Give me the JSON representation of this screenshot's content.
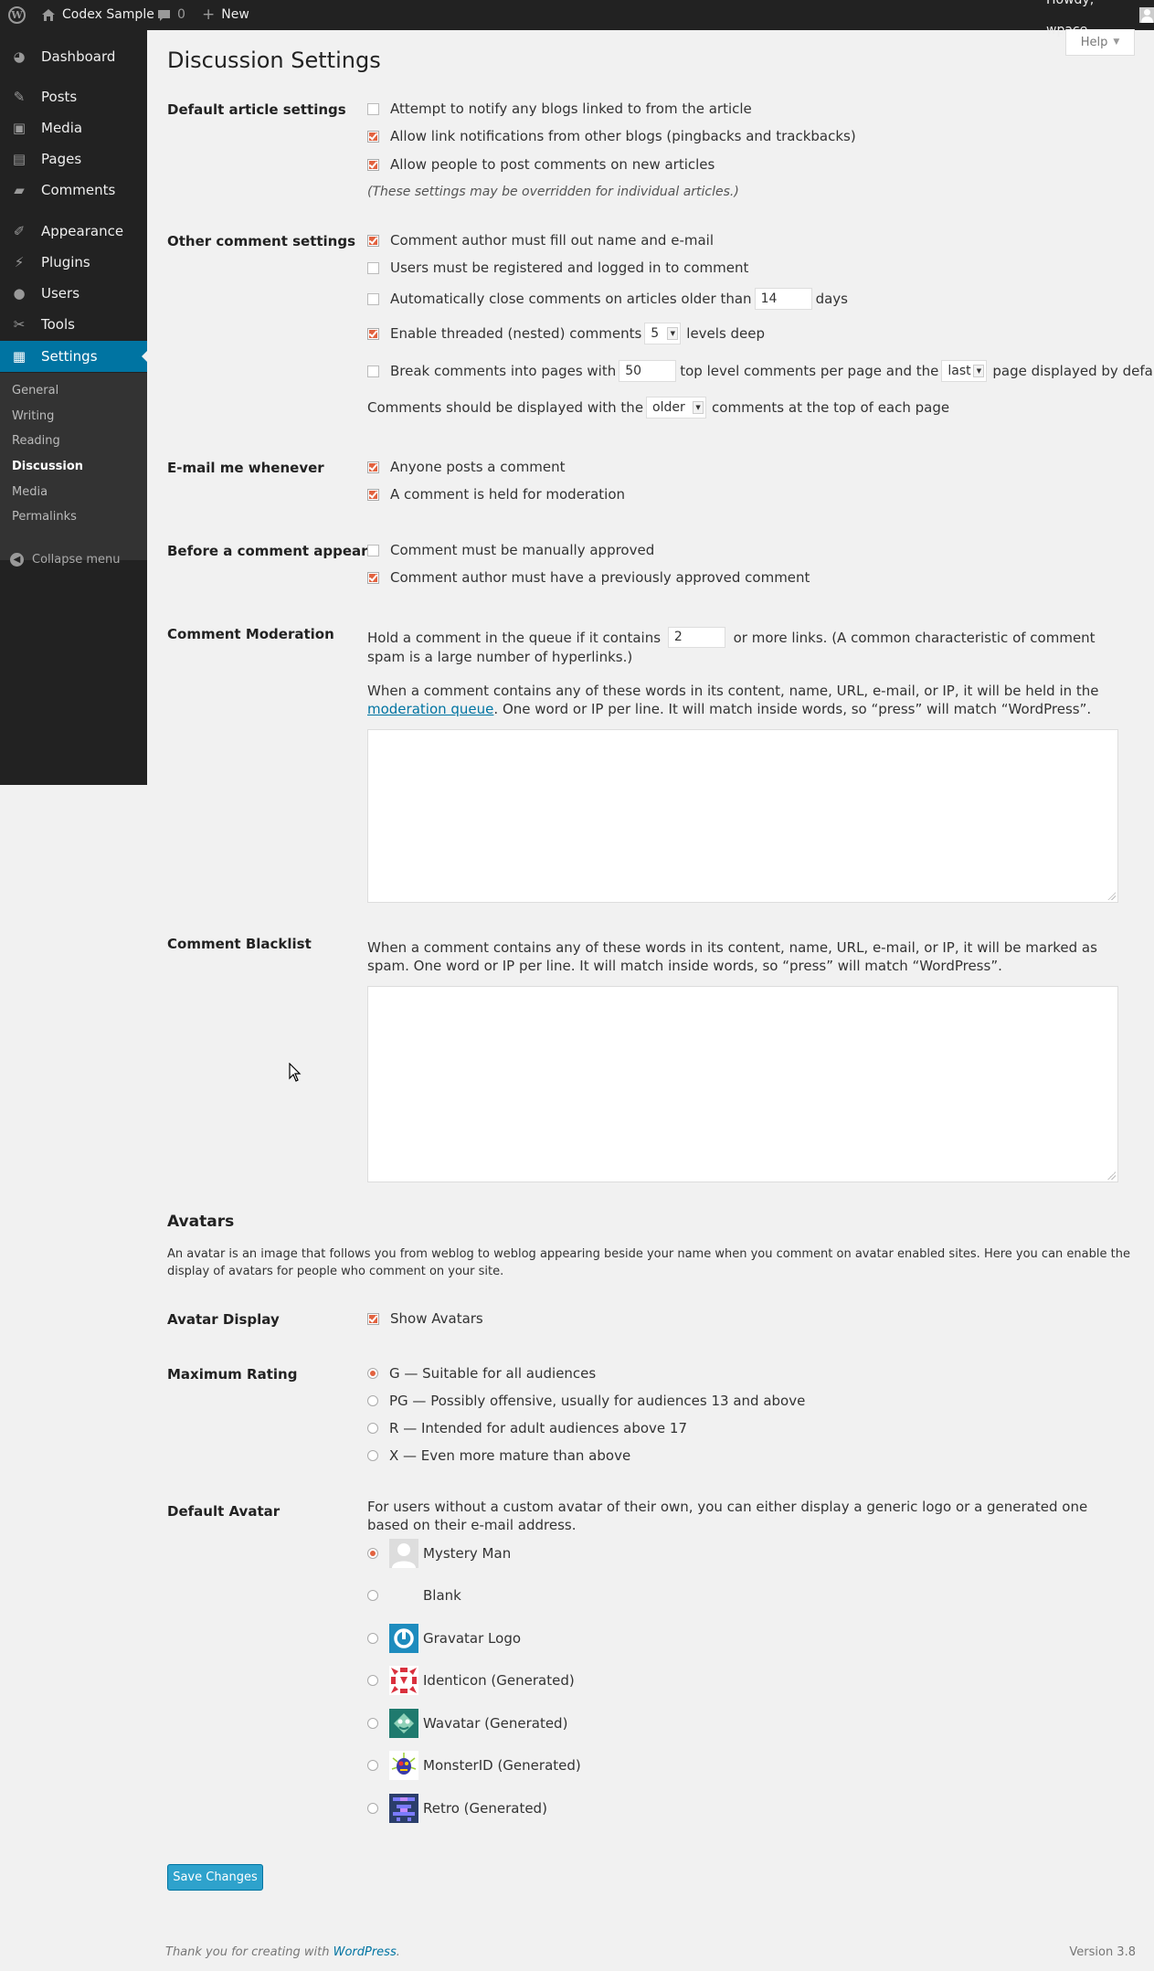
{
  "adminbar": {
    "site_name": "Codex Sample",
    "comments_count": "0",
    "new_label": "New",
    "howdy": "Howdy, wpace"
  },
  "sidebar": {
    "items": [
      {
        "label": "Dashboard",
        "icon": "dashboard-icon"
      },
      {
        "label": "Posts",
        "icon": "pin-icon"
      },
      {
        "label": "Media",
        "icon": "media-icon"
      },
      {
        "label": "Pages",
        "icon": "page-icon"
      },
      {
        "label": "Comments",
        "icon": "comment-icon"
      },
      {
        "label": "Appearance",
        "icon": "brush-icon"
      },
      {
        "label": "Plugins",
        "icon": "plugin-icon"
      },
      {
        "label": "Users",
        "icon": "user-icon"
      },
      {
        "label": "Tools",
        "icon": "wrench-icon"
      },
      {
        "label": "Settings",
        "icon": "settings-icon"
      }
    ],
    "submenu": [
      "General",
      "Writing",
      "Reading",
      "Discussion",
      "Media",
      "Permalinks"
    ],
    "collapse_label": "Collapse menu"
  },
  "page": {
    "title": "Discussion Settings",
    "help_label": "Help"
  },
  "default_article": {
    "label": "Default article settings",
    "options": [
      {
        "label": "Attempt to notify any blogs linked to from the article",
        "checked": false
      },
      {
        "label": "Allow link notifications from other blogs (pingbacks and trackbacks)",
        "checked": true
      },
      {
        "label": "Allow people to post comments on new articles",
        "checked": true
      }
    ],
    "note": "(These settings may be overridden for individual articles.)"
  },
  "other_comment": {
    "label": "Other comment settings",
    "author_fill": "Comment author must fill out name and e-mail",
    "registered": "Users must be registered and logged in to comment",
    "close_pre": "Automatically close comments on articles older than",
    "close_days": "14",
    "close_post": "days",
    "threaded_pre": "Enable threaded (nested) comments",
    "threaded_levels": "5",
    "threaded_post": "levels deep",
    "pages_pre": "Break comments into pages with",
    "pages_count": "50",
    "pages_mid": "top level comments per page and the",
    "pages_which": "last",
    "pages_post": "page displayed by default",
    "order_pre": "Comments should be displayed with the",
    "order_value": "older",
    "order_post": "comments at the top of each page"
  },
  "email_me": {
    "label": "E-mail me whenever",
    "options": [
      {
        "label": "Anyone posts a comment",
        "checked": true
      },
      {
        "label": "A comment is held for moderation",
        "checked": true
      }
    ]
  },
  "before_appears": {
    "label": "Before a comment appears",
    "options": [
      {
        "label": "Comment must be manually approved",
        "checked": false
      },
      {
        "label": "Comment author must have a previously approved comment",
        "checked": true
      }
    ]
  },
  "moderation": {
    "label": "Comment Moderation",
    "hold_pre": "Hold a comment in the queue if it contains",
    "links": "2",
    "hold_post": "or more links. (A common characteristic of comment spam is a large number of hyperlinks.)",
    "words_pre": "When a comment contains any of these words in its content, name, URL, e-mail, or IP, it will be held in the",
    "words_link": "moderation queue",
    "words_post": ". One word or IP per line. It will match inside words, so “press” will match “WordPress”."
  },
  "blacklist": {
    "label": "Comment Blacklist",
    "text": "When a comment contains any of these words in its content, name, URL, e-mail, or IP, it will be marked as spam. One word or IP per line. It will match inside words, so “press” will match “WordPress”."
  },
  "avatars": {
    "heading": "Avatars",
    "desc": "An avatar is an image that follows you from weblog to weblog appearing beside your name when you comment on avatar enabled sites. Here you can enable the display of avatars for people who comment on your site.",
    "display_label": "Avatar Display",
    "show_label": "Show Avatars",
    "rating_label": "Maximum Rating",
    "ratings": [
      "G — Suitable for all audiences",
      "PG — Possibly offensive, usually for audiences 13 and above",
      "R — Intended for adult audiences above 17",
      "X — Even more mature than above"
    ],
    "default_label": "Default Avatar",
    "default_desc": "For users without a custom avatar of their own, you can either display a generic logo or a generated one based on their e-mail address.",
    "defaults": [
      "Mystery Man",
      "Blank",
      "Gravatar Logo",
      "Identicon (Generated)",
      "Wavatar (Generated)",
      "MonsterID (Generated)",
      "Retro (Generated)"
    ]
  },
  "save_label": "Save Changes",
  "footer": {
    "thanks_pre": "Thank you for creating with",
    "thanks_link": "WordPress",
    "thanks_post": ".",
    "version": "Version 3.8"
  },
  "colors": {
    "accent": "#0074a2",
    "check": "#e2623f",
    "adminbar": "#222222"
  }
}
